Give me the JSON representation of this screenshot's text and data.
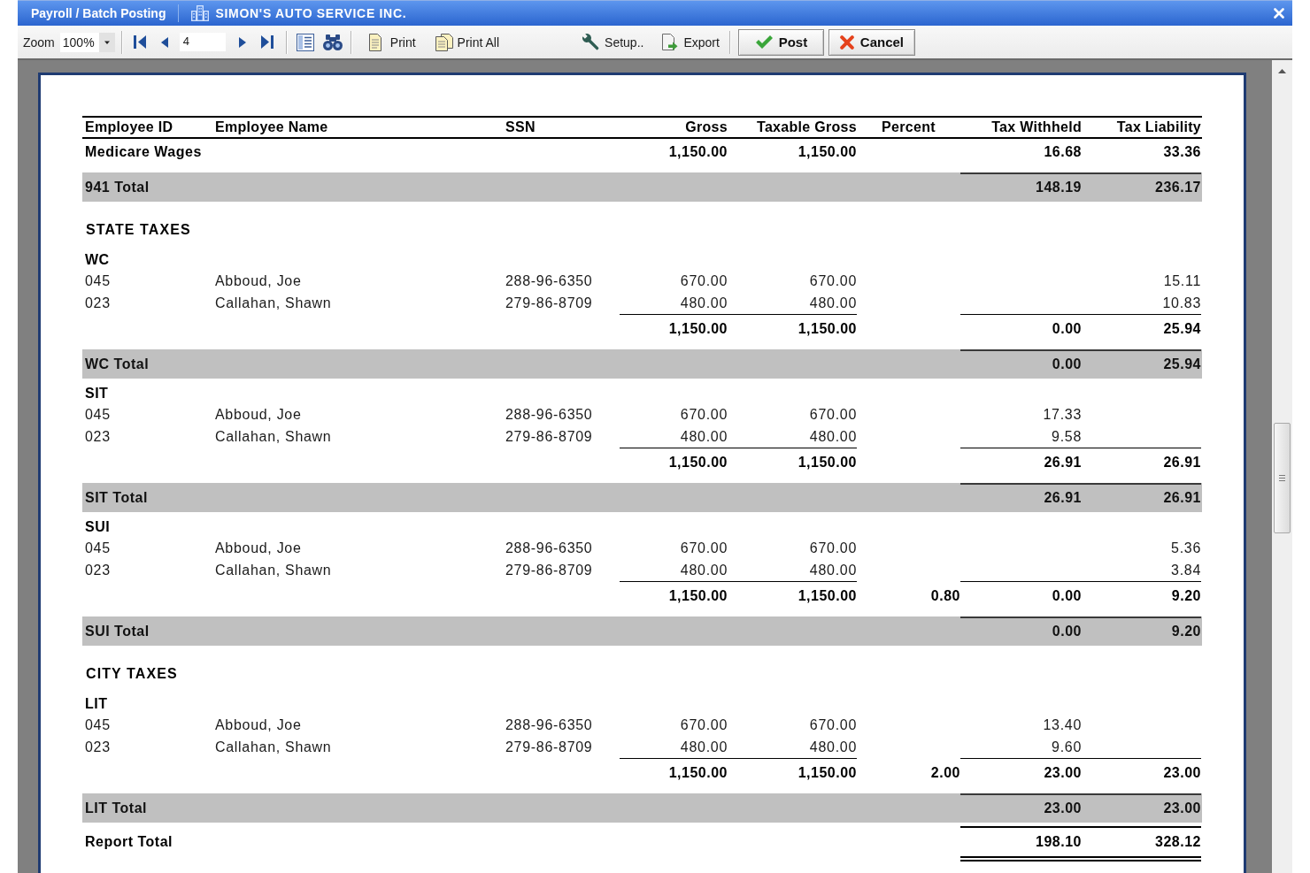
{
  "window": {
    "title": "Payroll / Batch Posting",
    "company": "SIMON'S AUTO SERVICE INC."
  },
  "toolbar": {
    "zoom_label": "Zoom",
    "zoom_value": "100%",
    "page_number": "4",
    "print": "Print",
    "print_all": "Print All",
    "setup": "Setup..",
    "export": "Export",
    "post": "Post",
    "cancel": "Cancel"
  },
  "report": {
    "columns": [
      "Employee ID",
      "Employee Name",
      "SSN",
      "Gross",
      "Taxable Gross",
      "Percent",
      "Tax Withheld",
      "Tax Liability"
    ],
    "rows": [
      {
        "kind": "summary",
        "label": "Medicare Wages",
        "gross": "1,150.00",
        "taxable_gross": "1,150.00",
        "tax_withheld": "16.68",
        "tax_liability": "33.36"
      },
      {
        "kind": "total",
        "label": "941 Total",
        "tax_withheld": "148.19",
        "tax_liability": "236.17"
      },
      {
        "kind": "section",
        "label": "STATE TAXES"
      },
      {
        "kind": "group",
        "label": "WC"
      },
      {
        "kind": "detail",
        "employee_id": "045",
        "employee_name": "Abboud, Joe",
        "ssn": "288-96-6350",
        "gross": "670.00",
        "taxable_gross": "670.00",
        "tax_liability": "15.11"
      },
      {
        "kind": "detail",
        "employee_id": "023",
        "employee_name": "Callahan, Shawn",
        "ssn": "279-86-8709",
        "gross": "480.00",
        "taxable_gross": "480.00",
        "tax_liability": "10.83"
      },
      {
        "kind": "subtotal",
        "gross": "1,150.00",
        "taxable_gross": "1,150.00",
        "tax_withheld": "0.00",
        "tax_liability": "25.94"
      },
      {
        "kind": "total",
        "label": "WC Total",
        "tax_withheld": "0.00",
        "tax_liability": "25.94"
      },
      {
        "kind": "group",
        "label": "SIT"
      },
      {
        "kind": "detail",
        "employee_id": "045",
        "employee_name": "Abboud, Joe",
        "ssn": "288-96-6350",
        "gross": "670.00",
        "taxable_gross": "670.00",
        "tax_withheld": "17.33"
      },
      {
        "kind": "detail",
        "employee_id": "023",
        "employee_name": "Callahan, Shawn",
        "ssn": "279-86-8709",
        "gross": "480.00",
        "taxable_gross": "480.00",
        "tax_withheld": "9.58"
      },
      {
        "kind": "subtotal",
        "gross": "1,150.00",
        "taxable_gross": "1,150.00",
        "tax_withheld": "26.91",
        "tax_liability": "26.91"
      },
      {
        "kind": "total",
        "label": "SIT Total",
        "tax_withheld": "26.91",
        "tax_liability": "26.91"
      },
      {
        "kind": "group",
        "label": "SUI"
      },
      {
        "kind": "detail",
        "employee_id": "045",
        "employee_name": "Abboud, Joe",
        "ssn": "288-96-6350",
        "gross": "670.00",
        "taxable_gross": "670.00",
        "tax_liability": "5.36"
      },
      {
        "kind": "detail",
        "employee_id": "023",
        "employee_name": "Callahan, Shawn",
        "ssn": "279-86-8709",
        "gross": "480.00",
        "taxable_gross": "480.00",
        "tax_liability": "3.84"
      },
      {
        "kind": "subtotal",
        "gross": "1,150.00",
        "taxable_gross": "1,150.00",
        "percent": "0.80",
        "tax_withheld": "0.00",
        "tax_liability": "9.20"
      },
      {
        "kind": "total",
        "label": "SUI Total",
        "tax_withheld": "0.00",
        "tax_liability": "9.20"
      },
      {
        "kind": "section",
        "label": "CITY TAXES"
      },
      {
        "kind": "group",
        "label": "LIT"
      },
      {
        "kind": "detail",
        "employee_id": "045",
        "employee_name": "Abboud, Joe",
        "ssn": "288-96-6350",
        "gross": "670.00",
        "taxable_gross": "670.00",
        "tax_withheld": "13.40"
      },
      {
        "kind": "detail",
        "employee_id": "023",
        "employee_name": "Callahan, Shawn",
        "ssn": "279-86-8709",
        "gross": "480.00",
        "taxable_gross": "480.00",
        "tax_withheld": "9.60"
      },
      {
        "kind": "subtotal",
        "gross": "1,150.00",
        "taxable_gross": "1,150.00",
        "percent": "2.00",
        "tax_withheld": "23.00",
        "tax_liability": "23.00"
      },
      {
        "kind": "total",
        "label": "LIT Total",
        "tax_withheld": "23.00",
        "tax_liability": "23.00"
      },
      {
        "kind": "grand_total",
        "label": "Report Total",
        "tax_withheld": "198.10",
        "tax_liability": "328.12"
      }
    ]
  }
}
